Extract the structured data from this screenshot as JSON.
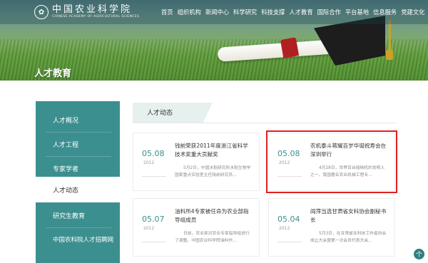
{
  "header": {
    "logo_cn": "中国农业科学院",
    "logo_en": "CHINESE ACADEMY OF AGRICULTURAL SCIENCES",
    "logo_icon": "academy-emblem-icon",
    "nav": [
      "首页",
      "组织机构",
      "新闻中心",
      "科学研究",
      "科技支撑",
      "人才教育",
      "国际合作",
      "平台基地",
      "信息服务",
      "党建文化"
    ]
  },
  "banner": {
    "title": "人才教育"
  },
  "sidebar": {
    "items": [
      {
        "label": "人才概况"
      },
      {
        "label": "人才工程"
      },
      {
        "label": "专家学者"
      },
      {
        "label": "人才动态"
      },
      {
        "label": "研究生教育"
      },
      {
        "label": "中国农科院人才招聘网"
      }
    ],
    "active_index": 3
  },
  "section": {
    "title": "人才动态"
  },
  "news": [
    {
      "date": "05.08",
      "year": "2012",
      "title": "钱前荣获2011年度浙江省科学技术奖重大贡献奖",
      "summary": "5月2日，中国水稻研究所水稻生物学国家重点实验室主任钱前研究员..."
    },
    {
      "date": "05.08",
      "year": "2012",
      "title": "农机泰斗蒋耀百岁华诞祝寿会在深圳举行",
      "summary": "4月28日，世界百台插秧机的发明人之一、我国著名农业机械工程专..."
    },
    {
      "date": "05.07",
      "year": "2012",
      "title": "油料所4专家被任命为农业部指导组成员",
      "summary": "日前，农业部对农业专家指导组进行了调整。中国农业科学院油料作..."
    },
    {
      "date": "05.04",
      "year": "2012",
      "title": "阎萍当选甘肃省女科协会副秘书长",
      "summary": "5月3日，在甘肃省女科技工作者协会成立大会暨第一次会员代表大会..."
    }
  ],
  "to_top": {
    "icon": "arrow-up-icon",
    "glyph": "个"
  },
  "colors": {
    "accent": "#3c8f8f",
    "highlight": "#e02020"
  }
}
